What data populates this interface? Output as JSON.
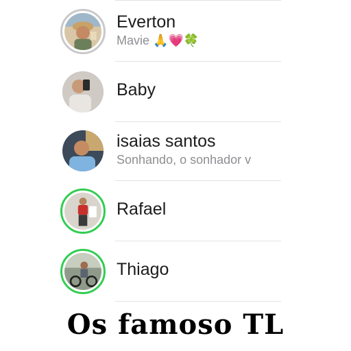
{
  "contacts": [
    {
      "name": "Everton",
      "status_text": "Mavie",
      "status_emojis": [
        "🙏",
        "💗",
        "🍀"
      ],
      "ring": "seen"
    },
    {
      "name": "Baby",
      "status_text": "",
      "ring": "none"
    },
    {
      "name": "isaias santos",
      "status_text": "Sonhando, o sonhador v",
      "ring": "none"
    },
    {
      "name": "Rafael",
      "status_text": "",
      "ring": "new"
    },
    {
      "name": "Thiago",
      "status_text": "",
      "ring": "new"
    }
  ],
  "caption": "Os famoso TL",
  "colors": {
    "status_ring_new": "#32cd52",
    "status_ring_seen": "#c9c9cc",
    "secondary_text": "#8e8e93",
    "divider": "#e2e2e6"
  },
  "icons": {
    "avatars": [
      "avatar-photo",
      "avatar-photo",
      "avatar-photo",
      "avatar-photo",
      "avatar-photo"
    ]
  }
}
